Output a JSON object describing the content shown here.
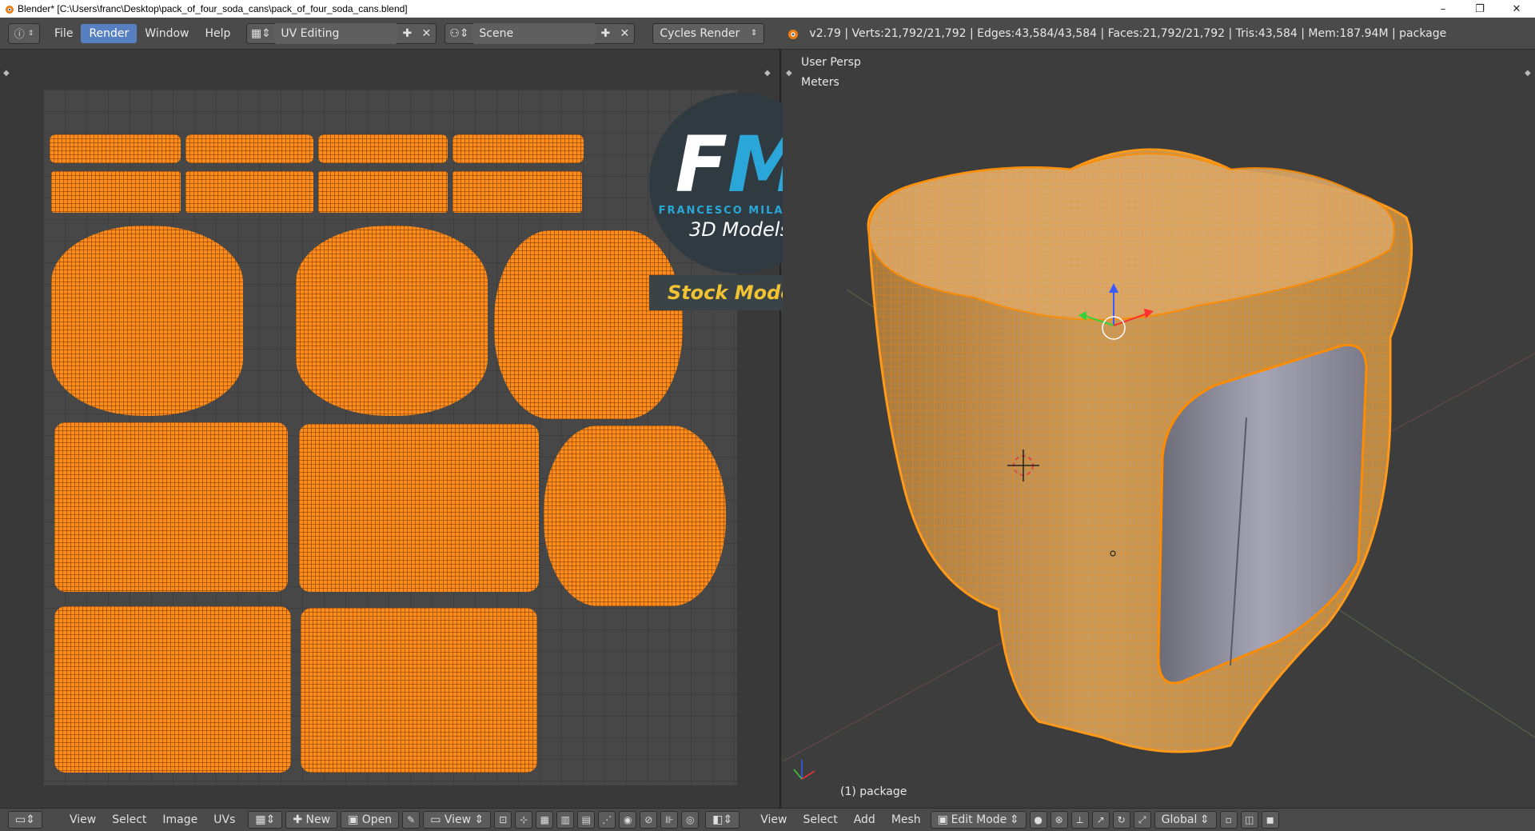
{
  "window": {
    "title": "Blender* [C:\\Users\\franc\\Desktop\\pack_of_four_soda_cans\\pack_of_four_soda_cans.blend]",
    "minimize": "–",
    "maximize": "❐",
    "close": "✕"
  },
  "infobar": {
    "menus": [
      {
        "label": "File"
      },
      {
        "label": "Render"
      },
      {
        "label": "Window"
      },
      {
        "label": "Help"
      }
    ],
    "active_menu": "Render",
    "screen_layout": "UV Editing",
    "scene": "Scene",
    "render_engine": "Cycles Render",
    "stats": "v2.79 | Verts:21,792/21,792 | Edges:43,584/43,584 | Faces:21,792/21,792 | Tris:43,584 | Mem:187.94M | package"
  },
  "viewport": {
    "view_name": "User Persp",
    "units": "Meters",
    "object_label": "(1) package"
  },
  "watermark": {
    "logo_f": "F",
    "logo_m": "M",
    "brand": "FRANCESCO MILANESE",
    "subtitle": "3D Models",
    "badge": "Stock Models"
  },
  "uv_footer": {
    "view": "View",
    "select": "Select",
    "image": "Image",
    "uvs": "UVs",
    "new_btn": "New",
    "open_btn": "Open",
    "view_btn": "View"
  },
  "vp_footer": {
    "view": "View",
    "select": "Select",
    "add": "Add",
    "mesh": "Mesh",
    "mode": "Edit Mode",
    "orientation": "Global"
  },
  "colors": {
    "uv_orange": "#ff8c1a",
    "accent_blue": "#5680c2",
    "brand_blue": "#2aa6d8",
    "badge_yellow": "#f1c232"
  }
}
